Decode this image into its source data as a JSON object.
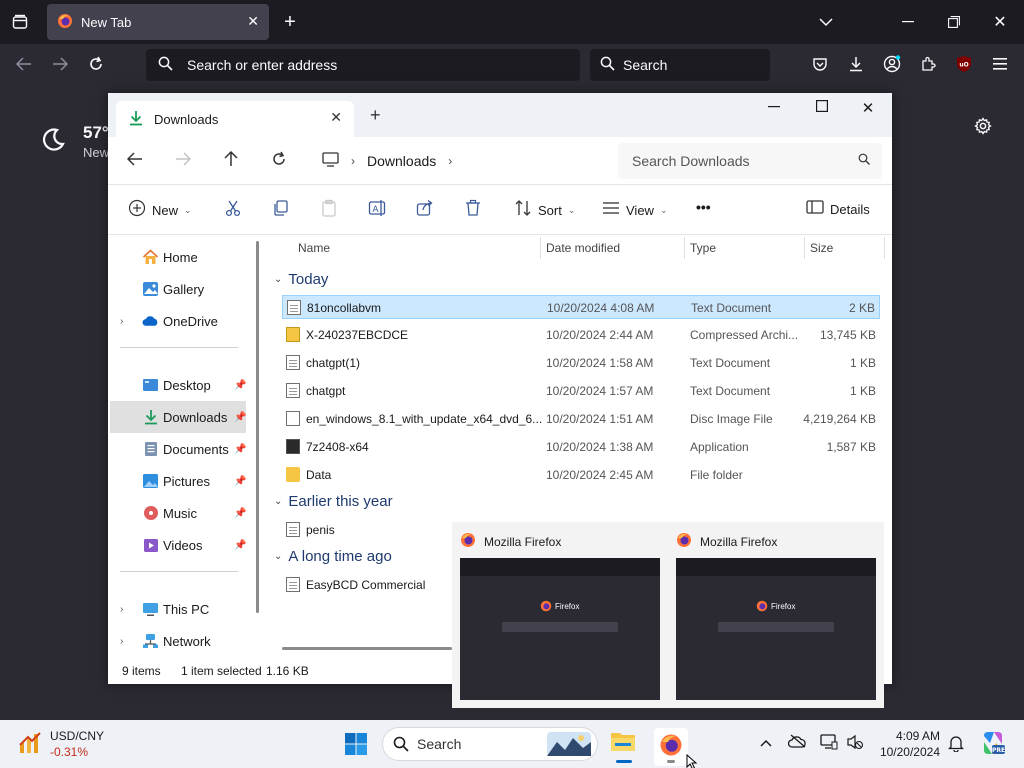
{
  "firefox": {
    "tab_title": "New Tab",
    "address_placeholder": "Search or enter address",
    "search_placeholder": "Search",
    "weather_temp": "57°",
    "weather_location": "New"
  },
  "explorer": {
    "tab_title": "Downloads",
    "breadcrumb": "Downloads",
    "search_placeholder": "Search Downloads",
    "commands": {
      "new": "New",
      "sort": "Sort",
      "view": "View",
      "more": "•••",
      "details": "Details"
    },
    "sidebar": {
      "home": "Home",
      "gallery": "Gallery",
      "onedrive": "OneDrive",
      "desktop": "Desktop",
      "downloads": "Downloads",
      "documents": "Documents",
      "pictures": "Pictures",
      "music": "Music",
      "videos": "Videos",
      "thispc": "This PC",
      "network": "Network"
    },
    "columns": {
      "name": "Name",
      "date": "Date modified",
      "type": "Type",
      "size": "Size"
    },
    "groups": {
      "today": "Today",
      "earlier": "Earlier this year",
      "longago": "A long time ago"
    },
    "files": [
      {
        "name": "81oncollabvm",
        "date": "10/20/2024 4:08 AM",
        "type": "Text Document",
        "size": "2 KB"
      },
      {
        "name": "X-240237EBCDCE",
        "date": "10/20/2024 2:44 AM",
        "type": "Compressed Archi...",
        "size": "13,745 KB"
      },
      {
        "name": "chatgpt(1)",
        "date": "10/20/2024 1:58 AM",
        "type": "Text Document",
        "size": "1 KB"
      },
      {
        "name": "chatgpt",
        "date": "10/20/2024 1:57 AM",
        "type": "Text Document",
        "size": "1 KB"
      },
      {
        "name": "en_windows_8.1_with_update_x64_dvd_6...",
        "date": "10/20/2024 1:51 AM",
        "type": "Disc Image File",
        "size": "4,219,264 KB"
      },
      {
        "name": "7z2408-x64",
        "date": "10/20/2024 1:38 AM",
        "type": "Application",
        "size": "1,587 KB"
      },
      {
        "name": "Data",
        "date": "10/20/2024 2:45 AM",
        "type": "File folder",
        "size": ""
      },
      {
        "name": "penis"
      },
      {
        "name": "EasyBCD Commercial"
      }
    ],
    "status": {
      "count": "9 items",
      "selection": "1 item selected",
      "selsize": "1.16 KB"
    }
  },
  "thumbnails": [
    {
      "title": "Mozilla Firefox",
      "preview_text": "Firefox"
    },
    {
      "title": "Mozilla Firefox",
      "preview_text": "Firefox"
    }
  ],
  "taskbar": {
    "stock_pair": "USD/CNY",
    "stock_change": "-0.31%",
    "search": "Search",
    "time": "4:09 AM",
    "date": "10/20/2024"
  },
  "colors": {
    "firefox_dark": "#1c1b22",
    "selection": "#cce8ff",
    "accent_blue": "#0067c0",
    "stock_down": "#c42b1c"
  }
}
